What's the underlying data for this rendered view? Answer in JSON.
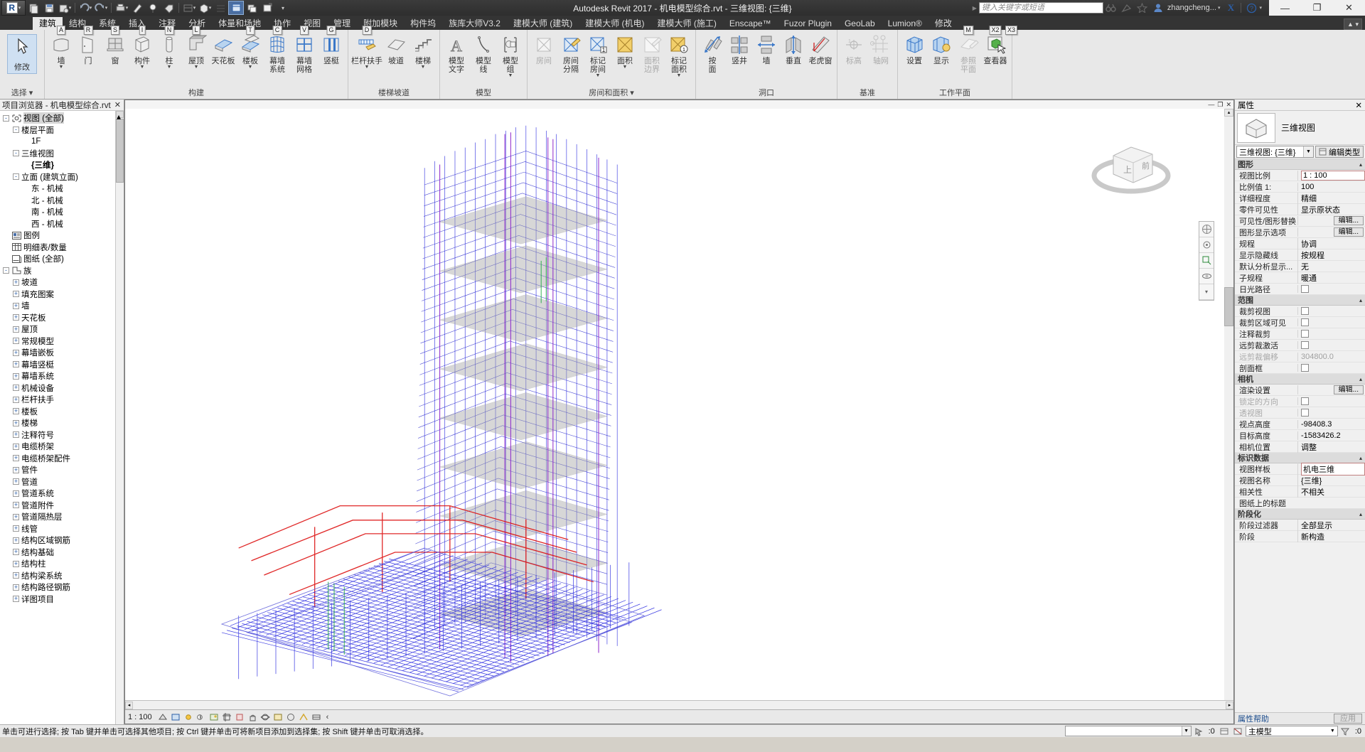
{
  "window": {
    "title": "Autodesk Revit 2017 -  机电模型综合.rvt - 三维视图: {三维}",
    "minimize": "—",
    "maximize": "❐",
    "close": "✕"
  },
  "quick_access": {
    "app_button": "R",
    "items": [
      "new-icon",
      "save-icon",
      "save-as-icon",
      "undo-icon",
      "redo-icon",
      "print-icon",
      "measure-icon",
      "align-icon",
      "dimension-icon",
      "tag-icon",
      "section-icon",
      "3dview-icon",
      "close-hidden-icon",
      "switch-window-icon",
      "customize-icon"
    ]
  },
  "account": {
    "search_placeholder": "键入关键字或短语",
    "icons": [
      "binoculars-icon",
      "satellite-icon",
      "star-icon"
    ],
    "user": "zhangcheng...",
    "exchange": "X",
    "help": "?"
  },
  "tabs": [
    {
      "label": "建筑",
      "active": true
    },
    {
      "label": "结构",
      "active": false
    },
    {
      "label": "系统",
      "active": false
    },
    {
      "label": "插入",
      "active": false
    },
    {
      "label": "注释",
      "active": false
    },
    {
      "label": "分析",
      "active": false
    },
    {
      "label": "体量和场地",
      "active": false
    },
    {
      "label": "协作",
      "active": false
    },
    {
      "label": "视图",
      "active": false
    },
    {
      "label": "管理",
      "active": false
    },
    {
      "label": "附加模块",
      "active": false
    },
    {
      "label": "构件坞",
      "active": false
    },
    {
      "label": "族库大师V3.2",
      "active": false
    },
    {
      "label": "建模大师 (建筑)",
      "active": false
    },
    {
      "label": "建模大师 (机电)",
      "active": false
    },
    {
      "label": "建模大师 (施工)",
      "active": false
    },
    {
      "label": "Enscape™",
      "active": false
    },
    {
      "label": "Fuzor Plugin",
      "active": false
    },
    {
      "label": "GeoLab",
      "active": false
    },
    {
      "label": "Lumion®",
      "active": false
    },
    {
      "label": "修改",
      "active": false
    }
  ],
  "ribbon": {
    "panels": [
      {
        "title": "选择",
        "has_dropdown": true,
        "items": [
          {
            "label": "修改",
            "icon": "cursor-icon",
            "key": "",
            "big": true
          }
        ]
      },
      {
        "title": "构建",
        "has_dropdown": false,
        "items": [
          {
            "label": "墙",
            "icon": "wall-icon",
            "key": "A",
            "dropdown": true
          },
          {
            "label": "门",
            "icon": "door-icon",
            "key": "R",
            "dropdown": false
          },
          {
            "label": "窗",
            "icon": "window-icon",
            "key": "S",
            "dropdown": false
          },
          {
            "label": "构件",
            "icon": "component-icon",
            "key": "I",
            "dropdown": true
          },
          {
            "label": "柱",
            "icon": "column-icon",
            "key": "N",
            "dropdown": true
          },
          {
            "label": "屋顶",
            "icon": "roof-icon",
            "key": "L",
            "dropdown": true
          },
          {
            "label": "天花板",
            "icon": "ceiling-icon",
            "key": "",
            "dropdown": false
          },
          {
            "label": "楼板",
            "icon": "floor-icon",
            "key": "T",
            "dropdown": true
          },
          {
            "label": "幕墙",
            "label2": "系统",
            "icon": "curtain-system-icon",
            "key": "C",
            "dropdown": false
          },
          {
            "label": "幕墙",
            "label2": "网格",
            "icon": "curtain-grid-icon",
            "key": "V",
            "dropdown": false
          },
          {
            "label": "竖梃",
            "icon": "mullion-icon",
            "key": "G",
            "dropdown": false
          }
        ]
      },
      {
        "title": "楼梯坡道",
        "has_dropdown": false,
        "items": [
          {
            "label": "栏杆扶手",
            "icon": "railing-icon",
            "key": "D",
            "dropdown": true
          },
          {
            "label": "坡道",
            "icon": "ramp-icon",
            "key": "",
            "dropdown": false
          },
          {
            "label": "楼梯",
            "icon": "stair-icon",
            "key": "",
            "dropdown": true
          }
        ]
      },
      {
        "title": "模型",
        "has_dropdown": false,
        "items": [
          {
            "label": "模型",
            "label2": "文字",
            "icon": "model-text-icon",
            "key": "",
            "dropdown": false
          },
          {
            "label": "模型",
            "label2": "线",
            "icon": "model-line-icon",
            "key": "",
            "dropdown": false
          },
          {
            "label": "模型",
            "label2": "组",
            "icon": "model-group-icon",
            "key": "",
            "dropdown": true
          }
        ]
      },
      {
        "title": "房间和面积",
        "has_dropdown": true,
        "items": [
          {
            "label": "房间",
            "icon": "room-icon",
            "key": "",
            "dropdown": false,
            "disabled": true
          },
          {
            "label": "房间",
            "label2": "分隔",
            "icon": "room-separator-icon",
            "key": "",
            "dropdown": false
          },
          {
            "label": "标记",
            "label2": "房间",
            "icon": "tag-room-icon",
            "key": "",
            "dropdown": true
          },
          {
            "label": "面积",
            "icon": "area-icon",
            "key": "",
            "dropdown": true
          },
          {
            "label": "面积",
            "label2": "边界",
            "icon": "area-boundary-icon",
            "key": "",
            "dropdown": false,
            "disabled": true
          },
          {
            "label": "标记",
            "label2": "面积",
            "icon": "tag-area-icon",
            "key": "",
            "dropdown": true
          }
        ]
      },
      {
        "title": "洞口",
        "has_dropdown": false,
        "items": [
          {
            "label": "按",
            "label2": "面",
            "icon": "by-face-icon",
            "key": "",
            "dropdown": false
          },
          {
            "label": "竖井",
            "icon": "shaft-icon",
            "key": "",
            "dropdown": false
          },
          {
            "label": "墙",
            "icon": "wall-opening-icon",
            "key": "",
            "dropdown": false
          },
          {
            "label": "垂直",
            "icon": "vertical-opening-icon",
            "key": "",
            "dropdown": false
          },
          {
            "label": "老虎窗",
            "icon": "dormer-icon",
            "key": "",
            "dropdown": false
          }
        ]
      },
      {
        "title": "基准",
        "has_dropdown": false,
        "items": [
          {
            "label": "标高",
            "icon": "level-icon",
            "key": "",
            "dropdown": false,
            "disabled": true
          },
          {
            "label": "轴网",
            "icon": "grid-icon",
            "key": "",
            "dropdown": false,
            "disabled": true
          }
        ]
      },
      {
        "title": "工作平面",
        "has_dropdown": false,
        "items": [
          {
            "label": "设置",
            "icon": "set-workplane-icon",
            "key": "",
            "dropdown": false
          },
          {
            "label": "显示",
            "icon": "show-workplane-icon",
            "key": "",
            "dropdown": false
          },
          {
            "label": "参照",
            "label2": "平面",
            "icon": "ref-plane-icon",
            "key": "M",
            "dropdown": false,
            "disabled": true
          },
          {
            "label": "查看器",
            "icon": "viewer-icon",
            "key": "X2",
            "key2": "X3",
            "dropdown": false
          }
        ]
      }
    ]
  },
  "browser": {
    "title": "项目浏览器 - 机电模型综合.rvt",
    "close": "✕",
    "tree": [
      {
        "level": 0,
        "label": "视图 (全部)",
        "expander": "-",
        "icon": "views-icon",
        "selected": true
      },
      {
        "level": 1,
        "label": "楼层平面",
        "expander": "-",
        "icon": ""
      },
      {
        "level": 2,
        "label": "1F",
        "expander": "",
        "icon": ""
      },
      {
        "level": 1,
        "label": "三维视图",
        "expander": "-",
        "icon": ""
      },
      {
        "level": 2,
        "label": "{三维}",
        "expander": "",
        "icon": "",
        "bold": true
      },
      {
        "level": 1,
        "label": "立面 (建筑立面)",
        "expander": "-",
        "icon": ""
      },
      {
        "level": 2,
        "label": "东 - 机械",
        "expander": "",
        "icon": ""
      },
      {
        "level": 2,
        "label": "北 - 机械",
        "expander": "",
        "icon": ""
      },
      {
        "level": 2,
        "label": "南 - 机械",
        "expander": "",
        "icon": ""
      },
      {
        "level": 2,
        "label": "西 - 机械",
        "expander": "",
        "icon": ""
      },
      {
        "level": 0,
        "label": "图例",
        "expander": "",
        "icon": "legend-icon"
      },
      {
        "level": 0,
        "label": "明细表/数量",
        "expander": "",
        "icon": "schedule-icon"
      },
      {
        "level": 0,
        "label": "图纸 (全部)",
        "expander": "",
        "icon": "sheet-icon"
      },
      {
        "level": 0,
        "label": "族",
        "expander": "-",
        "icon": "family-icon"
      },
      {
        "level": 1,
        "label": "坡道",
        "expander": "+",
        "icon": ""
      },
      {
        "level": 1,
        "label": "填充图案",
        "expander": "+",
        "icon": ""
      },
      {
        "level": 1,
        "label": "墙",
        "expander": "+",
        "icon": ""
      },
      {
        "level": 1,
        "label": "天花板",
        "expander": "+",
        "icon": ""
      },
      {
        "level": 1,
        "label": "屋顶",
        "expander": "+",
        "icon": ""
      },
      {
        "level": 1,
        "label": "常规模型",
        "expander": "+",
        "icon": ""
      },
      {
        "level": 1,
        "label": "幕墙嵌板",
        "expander": "+",
        "icon": ""
      },
      {
        "level": 1,
        "label": "幕墙竖梃",
        "expander": "+",
        "icon": ""
      },
      {
        "level": 1,
        "label": "幕墙系统",
        "expander": "+",
        "icon": ""
      },
      {
        "level": 1,
        "label": "机械设备",
        "expander": "+",
        "icon": ""
      },
      {
        "level": 1,
        "label": "栏杆扶手",
        "expander": "+",
        "icon": ""
      },
      {
        "level": 1,
        "label": "楼板",
        "expander": "+",
        "icon": ""
      },
      {
        "level": 1,
        "label": "楼梯",
        "expander": "+",
        "icon": ""
      },
      {
        "level": 1,
        "label": "注释符号",
        "expander": "+",
        "icon": ""
      },
      {
        "level": 1,
        "label": "电缆桥架",
        "expander": "+",
        "icon": ""
      },
      {
        "level": 1,
        "label": "电缆桥架配件",
        "expander": "+",
        "icon": ""
      },
      {
        "level": 1,
        "label": "管件",
        "expander": "+",
        "icon": ""
      },
      {
        "level": 1,
        "label": "管道",
        "expander": "+",
        "icon": ""
      },
      {
        "level": 1,
        "label": "管道系统",
        "expander": "+",
        "icon": ""
      },
      {
        "level": 1,
        "label": "管道附件",
        "expander": "+",
        "icon": ""
      },
      {
        "level": 1,
        "label": "管道隔热层",
        "expander": "+",
        "icon": ""
      },
      {
        "level": 1,
        "label": "线管",
        "expander": "+",
        "icon": ""
      },
      {
        "level": 1,
        "label": "结构区域钢筋",
        "expander": "+",
        "icon": ""
      },
      {
        "level": 1,
        "label": "结构基础",
        "expander": "+",
        "icon": ""
      },
      {
        "level": 1,
        "label": "结构柱",
        "expander": "+",
        "icon": ""
      },
      {
        "level": 1,
        "label": "结构梁系统",
        "expander": "+",
        "icon": ""
      },
      {
        "level": 1,
        "label": "结构路径钢筋",
        "expander": "+",
        "icon": ""
      },
      {
        "level": 1,
        "label": "详图项目",
        "expander": "+",
        "icon": ""
      }
    ]
  },
  "properties": {
    "title": "属性",
    "close": "✕",
    "type_name": "三维视图",
    "selector_value": "三维视图: {三维}",
    "edit_type_label": "编辑类型",
    "groups": [
      {
        "name": "图形",
        "rows": [
          {
            "name": "视图比例",
            "value": "1 : 100",
            "type": "text",
            "highlight": true
          },
          {
            "name": "比例值    1:",
            "value": "100",
            "type": "text"
          },
          {
            "name": "详细程度",
            "value": "精细",
            "type": "text"
          },
          {
            "name": "零件可见性",
            "value": "显示原状态",
            "type": "text"
          },
          {
            "name": "可见性/图形替换",
            "value": "编辑...",
            "type": "button"
          },
          {
            "name": "图形显示选项",
            "value": "编辑...",
            "type": "button"
          },
          {
            "name": "规程",
            "value": "协调",
            "type": "text"
          },
          {
            "name": "显示隐藏线",
            "value": "按规程",
            "type": "text"
          },
          {
            "name": "默认分析显示...",
            "value": "无",
            "type": "text"
          },
          {
            "name": "子规程",
            "value": "暖通",
            "type": "text"
          },
          {
            "name": "日光路径",
            "value": "",
            "type": "check"
          }
        ]
      },
      {
        "name": "范围",
        "rows": [
          {
            "name": "裁剪视图",
            "value": "",
            "type": "check"
          },
          {
            "name": "裁剪区域可见",
            "value": "",
            "type": "check"
          },
          {
            "name": "注释裁剪",
            "value": "",
            "type": "check"
          },
          {
            "name": "远剪裁激活",
            "value": "",
            "type": "check"
          },
          {
            "name": "远剪裁偏移",
            "value": "304800.0",
            "type": "text",
            "disabled": true
          },
          {
            "name": "剖面框",
            "value": "",
            "type": "check"
          }
        ]
      },
      {
        "name": "相机",
        "rows": [
          {
            "name": "渲染设置",
            "value": "编辑...",
            "type": "button"
          },
          {
            "name": "锁定的方向",
            "value": "",
            "type": "check",
            "disabled": true
          },
          {
            "name": "透视图",
            "value": "",
            "type": "check",
            "disabled": true
          },
          {
            "name": "视点高度",
            "value": "-98408.3",
            "type": "text"
          },
          {
            "name": "目标高度",
            "value": "-1583426.2",
            "type": "text"
          },
          {
            "name": "相机位置",
            "value": "调整",
            "type": "text"
          }
        ]
      },
      {
        "name": "标识数据",
        "rows": [
          {
            "name": "视图样板",
            "value": "机电三维",
            "type": "text",
            "highlight": true
          },
          {
            "name": "视图名称",
            "value": "{三维}",
            "type": "text"
          },
          {
            "name": "相关性",
            "value": "不相关",
            "type": "text"
          },
          {
            "name": "图纸上的标题",
            "value": "",
            "type": "text"
          }
        ]
      },
      {
        "name": "阶段化",
        "rows": [
          {
            "name": "阶段过滤器",
            "value": "全部显示",
            "type": "text"
          },
          {
            "name": "阶段",
            "value": "新构造",
            "type": "text"
          }
        ]
      }
    ],
    "help_label": "属性帮助",
    "apply_label": "应用"
  },
  "view_control": {
    "scale": "1 : 100",
    "icons": [
      "detail-level-icon",
      "visual-style-icon",
      "sun-path-icon",
      "shadows-icon",
      "render-icon",
      "crop-view-icon",
      "crop-region-icon",
      "lock-3d-icon",
      "temp-hide-icon",
      "reveal-hidden-icon",
      "analytical-model-icon",
      "constraints-icon",
      "more-icon"
    ],
    "expand": "‹"
  },
  "canvas_topbar": {
    "minimize": "—",
    "restore": "❐",
    "close": "✕"
  },
  "statusbar": {
    "message": "单击可进行选择; 按 Tab 键并单击可选择其他项目; 按 Ctrl 键并单击可将新项目添加到选择集; 按 Shift 键并单击可取消选择。",
    "workset_value": "",
    "design_option": "主模型",
    "selection_count": ":0",
    "filter_icon": "filter-icon",
    "icons": [
      "press-drag-icon",
      "editable-only-icon",
      "exclude-options-icon",
      "filter-icon"
    ]
  },
  "colors": {
    "accent": "#2c5fa8",
    "tab_active_bg": "#e8e8e8",
    "ribbon_bg": "#e8e8e8",
    "titlebar_bg": "#2e2e2e",
    "model_blue": "#1515d8",
    "model_red": "#d81010",
    "model_gray": "#9a9a9a"
  }
}
